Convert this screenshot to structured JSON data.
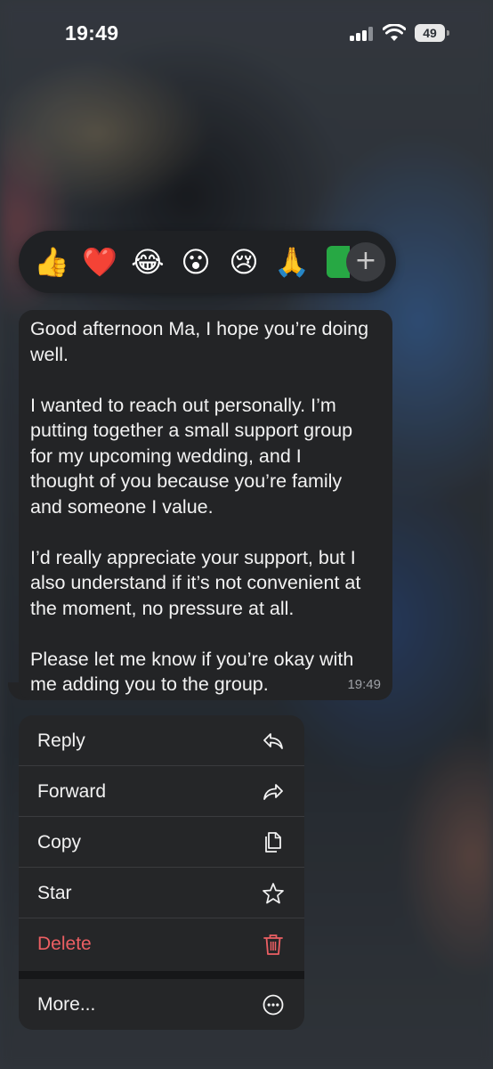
{
  "status_bar": {
    "time": "19:49",
    "battery_level": "49",
    "signal_bars": 3,
    "icons": [
      "cellular-signal-icon",
      "wifi-icon",
      "battery-icon"
    ]
  },
  "reactions": {
    "items": [
      {
        "emoji": "👍",
        "name": "thumbs-up"
      },
      {
        "emoji": "❤️",
        "name": "red-heart"
      },
      {
        "emoji": "😂",
        "name": "tears-of-joy"
      },
      {
        "emoji": "😮",
        "name": "surprised-face"
      },
      {
        "emoji": "😢",
        "name": "crying-face"
      },
      {
        "emoji": "🙏",
        "name": "folded-hands"
      }
    ],
    "add_icon": "+"
  },
  "message": {
    "text": "Good afternoon Ma, I hope you’re doing\nwell.\n\nI wanted to reach out personally. I’m\nputting together a small support group\nfor my upcoming wedding, and I\nthought of you because you’re family\nand someone I value.\n\nI’d really appreciate your support, but I\nalso understand if it’s not convenient at\nthe moment, no pressure at all.\n\nPlease let me know if you’re okay with\nme adding you to the group.",
    "time": "19:49"
  },
  "menu": {
    "items": [
      {
        "label": "Reply",
        "icon": "reply-icon"
      },
      {
        "label": "Forward",
        "icon": "forward-icon"
      },
      {
        "label": "Copy",
        "icon": "copy-icon"
      },
      {
        "label": "Star",
        "icon": "star-icon"
      },
      {
        "label": "Delete",
        "icon": "trash-icon"
      }
    ],
    "more": {
      "label": "More...",
      "icon": "more-icon"
    }
  },
  "colors": {
    "menu_background": "#252628",
    "bubble_background": "#232426",
    "danger": "#ec5f63",
    "reaction_bar": "#1f2124"
  }
}
